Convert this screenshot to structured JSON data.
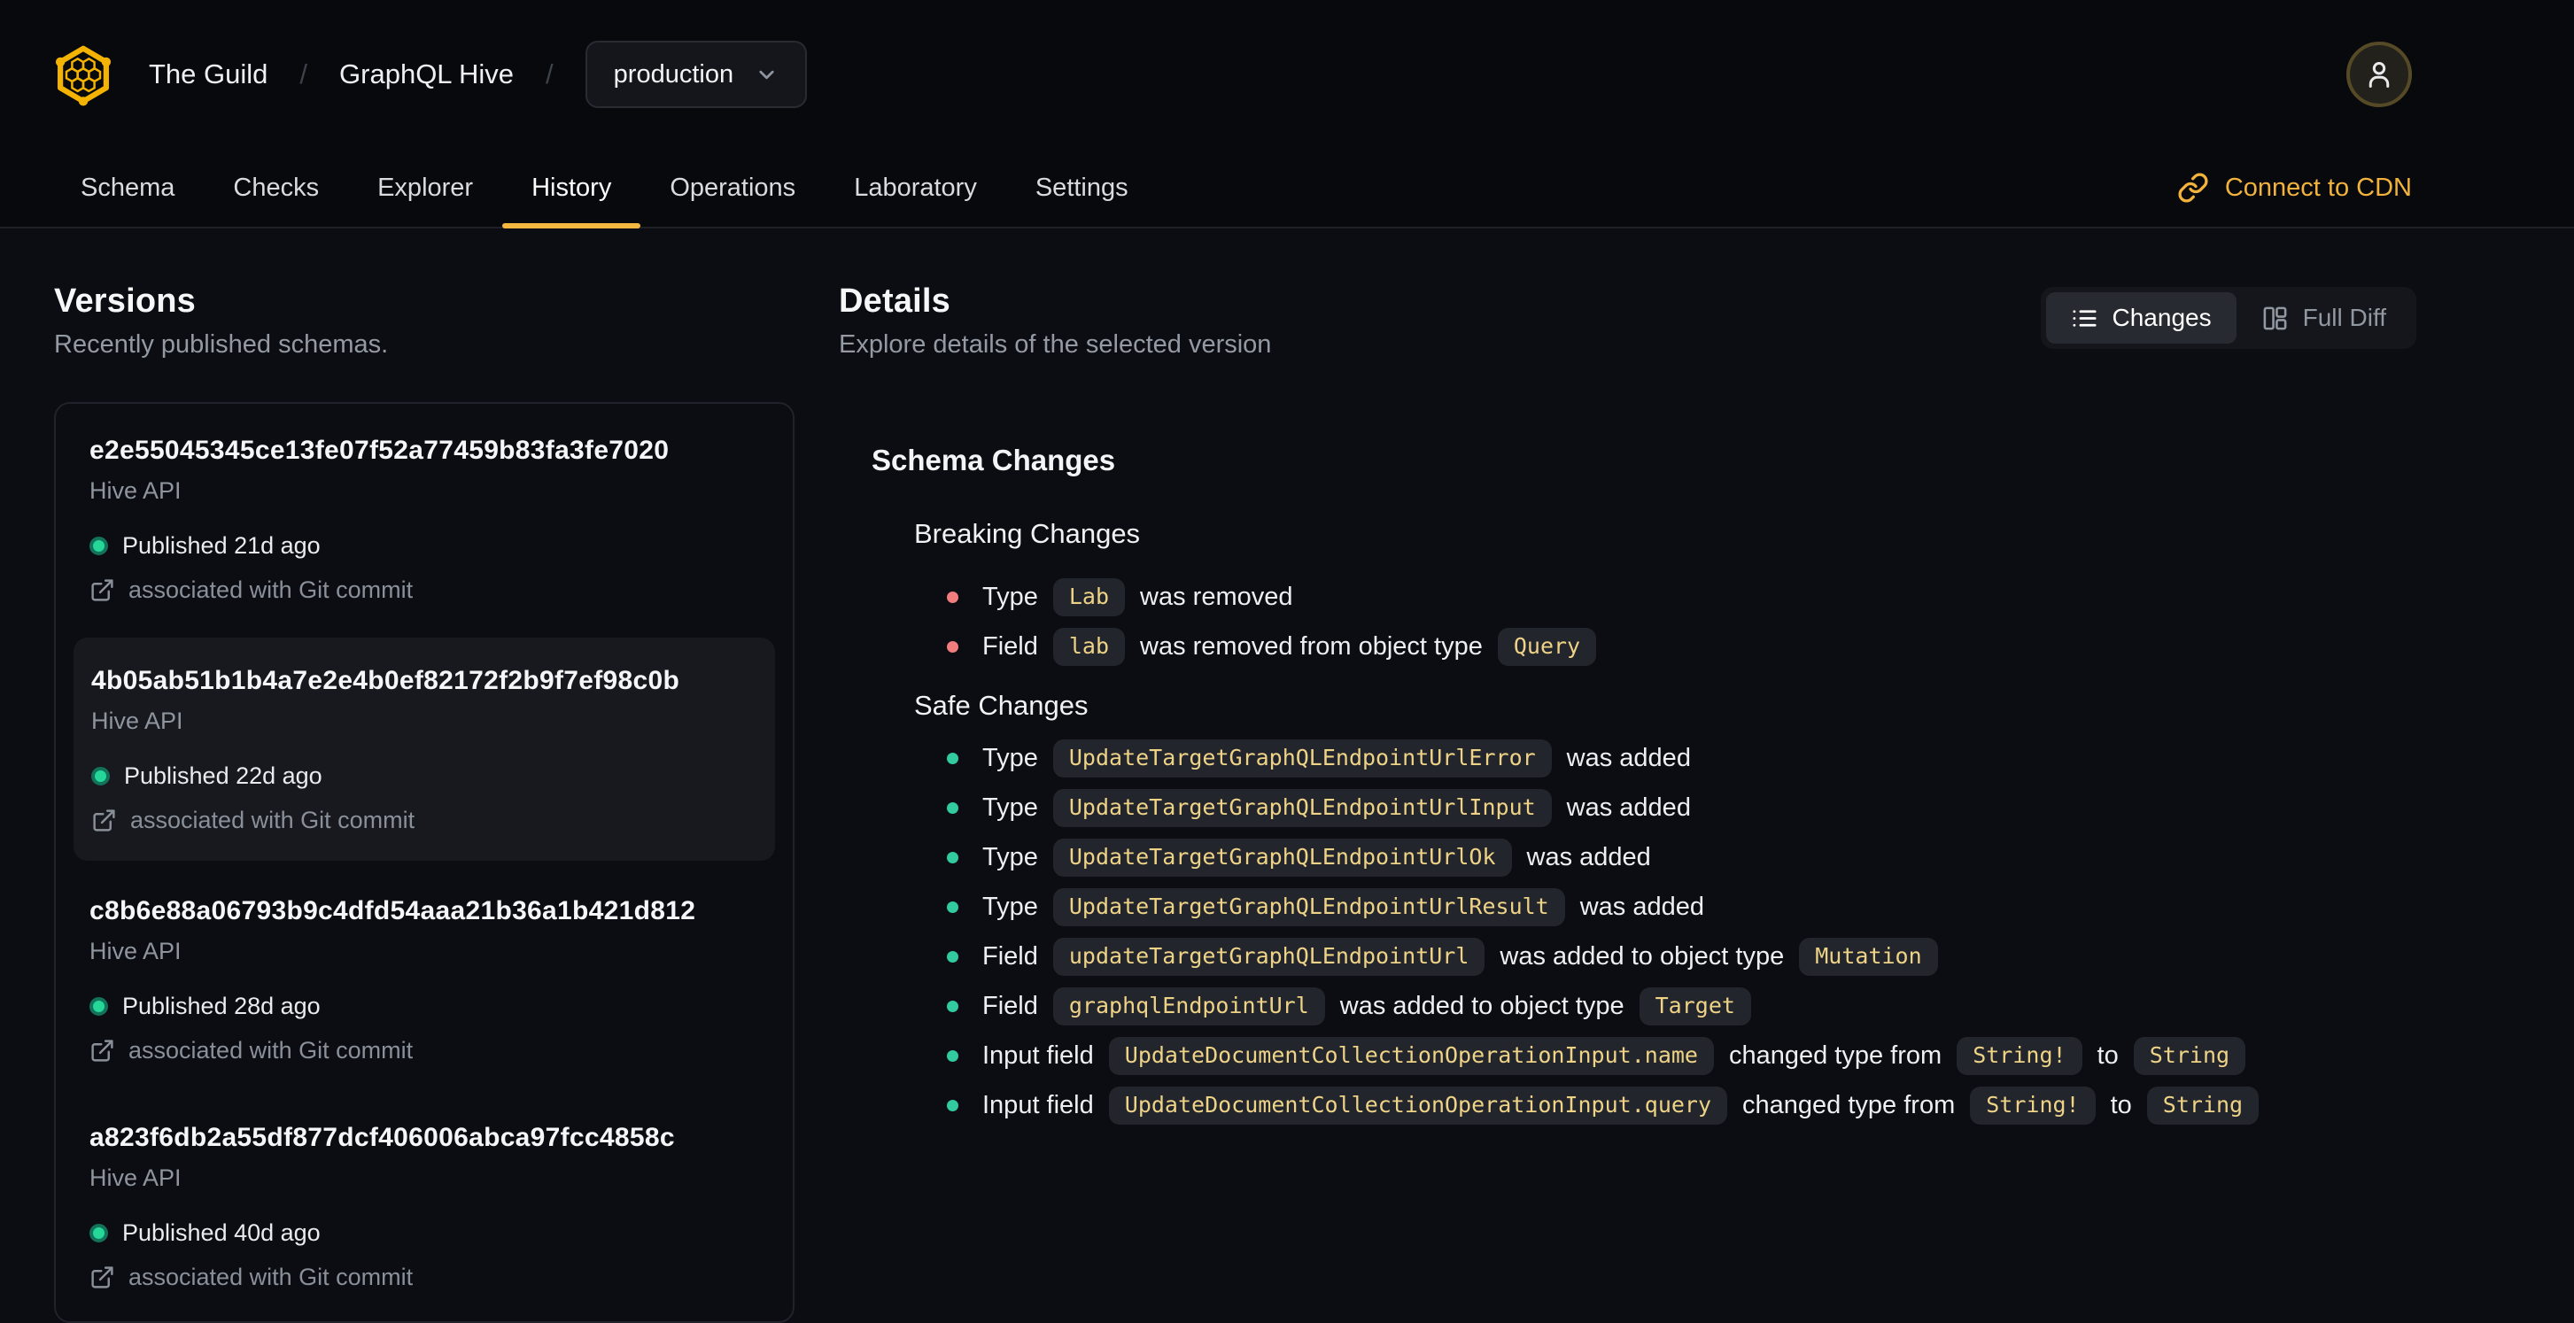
{
  "header": {
    "org": "The Guild",
    "separator": "/",
    "project": "GraphQL Hive",
    "target_selector": {
      "value": "production"
    },
    "tabs": [
      {
        "label": "Schema",
        "active": false
      },
      {
        "label": "Checks",
        "active": false
      },
      {
        "label": "Explorer",
        "active": false
      },
      {
        "label": "History",
        "active": true
      },
      {
        "label": "Operations",
        "active": false
      },
      {
        "label": "Laboratory",
        "active": false
      },
      {
        "label": "Settings",
        "active": false
      }
    ],
    "connect_cdn": "Connect to CDN"
  },
  "versions": {
    "title": "Versions",
    "subtitle": "Recently published schemas.",
    "items": [
      {
        "hash": "e2e55045345ce13fe07f52a77459b83fa3fe7020",
        "service": "Hive API",
        "published": "Published 21d ago",
        "commit": "associated with Git commit",
        "selected": false
      },
      {
        "hash": "4b05ab51b1b4a7e2e4b0ef82172f2b9f7ef98c0b",
        "service": "Hive API",
        "published": "Published 22d ago",
        "commit": "associated with Git commit",
        "selected": true
      },
      {
        "hash": "c8b6e88a06793b9c4dfd54aaa21b36a1b421d812",
        "service": "Hive API",
        "published": "Published 28d ago",
        "commit": "associated with Git commit",
        "selected": false
      },
      {
        "hash": "a823f6db2a55df877dcf406006abca97fcc4858c",
        "service": "Hive API",
        "published": "Published 40d ago",
        "commit": "associated with Git commit",
        "selected": false
      }
    ]
  },
  "details": {
    "title": "Details",
    "subtitle": "Explore details of the selected version",
    "view_toggle": {
      "changes": "Changes",
      "full_diff": "Full Diff",
      "selected": "Changes"
    },
    "schema_changes_title": "Schema Changes",
    "groups": [
      {
        "title": "Breaking Changes",
        "severity": "breaking",
        "items": [
          [
            {
              "t": "Type"
            },
            {
              "c": "Lab"
            },
            {
              "t": "was removed"
            }
          ],
          [
            {
              "t": "Field"
            },
            {
              "c": "lab"
            },
            {
              "t": "was removed from object type"
            },
            {
              "c": "Query"
            }
          ]
        ]
      },
      {
        "title": "Safe Changes",
        "severity": "safe",
        "items": [
          [
            {
              "t": "Type"
            },
            {
              "c": "UpdateTargetGraphQLEndpointUrlError"
            },
            {
              "t": "was added"
            }
          ],
          [
            {
              "t": "Type"
            },
            {
              "c": "UpdateTargetGraphQLEndpointUrlInput"
            },
            {
              "t": "was added"
            }
          ],
          [
            {
              "t": "Type"
            },
            {
              "c": "UpdateTargetGraphQLEndpointUrlOk"
            },
            {
              "t": "was added"
            }
          ],
          [
            {
              "t": "Type"
            },
            {
              "c": "UpdateTargetGraphQLEndpointUrlResult"
            },
            {
              "t": "was added"
            }
          ],
          [
            {
              "t": "Field"
            },
            {
              "c": "updateTargetGraphQLEndpointUrl"
            },
            {
              "t": "was added to object type"
            },
            {
              "c": "Mutation"
            }
          ],
          [
            {
              "t": "Field"
            },
            {
              "c": "graphqlEndpointUrl"
            },
            {
              "t": "was added to object type"
            },
            {
              "c": "Target"
            }
          ],
          [
            {
              "t": "Input field"
            },
            {
              "c": "UpdateDocumentCollectionOperationInput.name"
            },
            {
              "t": "changed type from"
            },
            {
              "c": "String!"
            },
            {
              "t": "to"
            },
            {
              "c": "String"
            }
          ],
          [
            {
              "t": "Input field"
            },
            {
              "c": "UpdateDocumentCollectionOperationInput.query"
            },
            {
              "t": "changed type from"
            },
            {
              "c": "String!"
            },
            {
              "t": "to"
            },
            {
              "c": "String"
            }
          ]
        ]
      }
    ]
  },
  "colors": {
    "accent": "#f4b740",
    "logo": "#f5b301",
    "cdn_link": "#f2b33d",
    "breaking_bullet": "#f27d7d",
    "safe_bullet": "#32ca9f",
    "chip_text": "#eed387",
    "published_dot": "#25d89a",
    "selected_card_bg": "#17191f"
  }
}
